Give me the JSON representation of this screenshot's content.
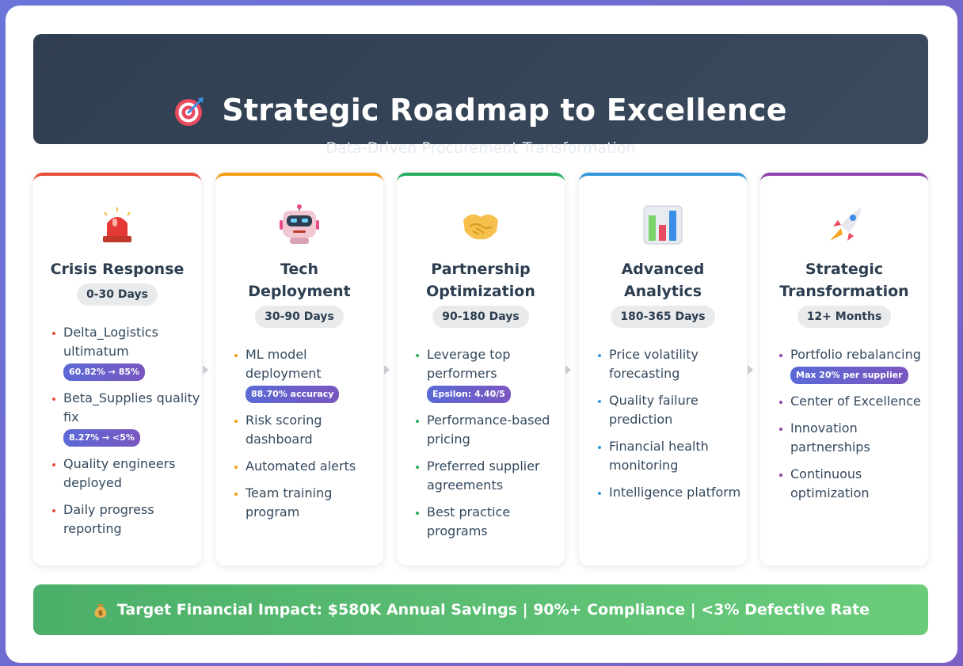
{
  "header": {
    "title": "Strategic Roadmap to Excellence",
    "subtitle": "Data-Driven Procurement Transformation",
    "icon": "target-icon"
  },
  "phases": [
    {
      "icon": "siren-icon",
      "color": "#e74c3c",
      "title": "Crisis Response",
      "period": "0-30 Days",
      "items": [
        {
          "text": "Delta_Logistics ultimatum",
          "metric": "60.82% → 85%"
        },
        {
          "text": "Beta_Supplies quality fix",
          "metric": "8.27% → <5%"
        },
        {
          "text": "Quality engineers deployed"
        },
        {
          "text": "Daily progress reporting"
        }
      ]
    },
    {
      "icon": "robot-icon",
      "color": "#f39c12",
      "title": "Tech Deployment",
      "period": "30-90 Days",
      "items": [
        {
          "text": "ML model deployment",
          "metric": "88.70% accuracy"
        },
        {
          "text": "Risk scoring dashboard"
        },
        {
          "text": "Automated alerts"
        },
        {
          "text": "Team training program"
        }
      ]
    },
    {
      "icon": "handshake-icon",
      "color": "#27ae60",
      "title": "Partnership Optimization",
      "period": "90-180 Days",
      "items": [
        {
          "text": "Leverage top performers",
          "metric": "Epsilon: 4.40/5"
        },
        {
          "text": "Performance-based pricing"
        },
        {
          "text": "Preferred supplier agreements"
        },
        {
          "text": "Best practice programs"
        }
      ]
    },
    {
      "icon": "bar-chart-icon",
      "color": "#3498db",
      "title": "Advanced Analytics",
      "period": "180-365 Days",
      "items": [
        {
          "text": "Price volatility forecasting"
        },
        {
          "text": "Quality failure prediction"
        },
        {
          "text": "Financial health monitoring"
        },
        {
          "text": "Intelligence platform"
        }
      ]
    },
    {
      "icon": "rocket-icon",
      "color": "#8e44ad",
      "title": "Strategic Transformation",
      "period": "12+ Months",
      "items": [
        {
          "text": "Portfolio rebalancing",
          "metric": "Max 20% per supplier"
        },
        {
          "text": "Center of Excellence"
        },
        {
          "text": "Innovation partnerships"
        },
        {
          "text": "Continuous optimization"
        }
      ]
    }
  ],
  "footer": {
    "icon": "money-bag-icon",
    "text": "Target Financial Impact: $580K Annual Savings | 90%+ Compliance | <3% Defective Rate"
  }
}
